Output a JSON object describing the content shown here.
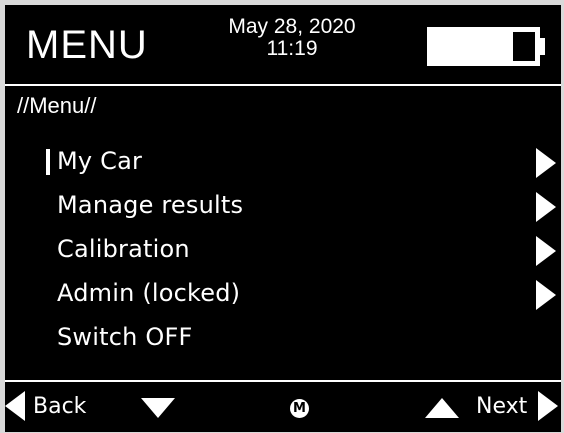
{
  "header": {
    "title": "MENU",
    "date": "May 28, 2020",
    "time": "11:19",
    "battery_icon": "battery-icon"
  },
  "breadcrumb": "//Menu//",
  "menu": {
    "items": [
      {
        "label": "My Car",
        "selected": true,
        "has_arrow": true
      },
      {
        "label": "Manage results",
        "selected": false,
        "has_arrow": true
      },
      {
        "label": "Calibration",
        "selected": false,
        "has_arrow": true
      },
      {
        "label": "Admin (locked)",
        "selected": false,
        "has_arrow": true
      },
      {
        "label": "Switch OFF",
        "selected": false,
        "has_arrow": false
      }
    ]
  },
  "footer": {
    "back_label": "Back",
    "menu_button_label": "M",
    "next_label": "Next"
  },
  "colors": {
    "background": "#000000",
    "foreground": "#ffffff",
    "frame": "#d9d9d9"
  }
}
